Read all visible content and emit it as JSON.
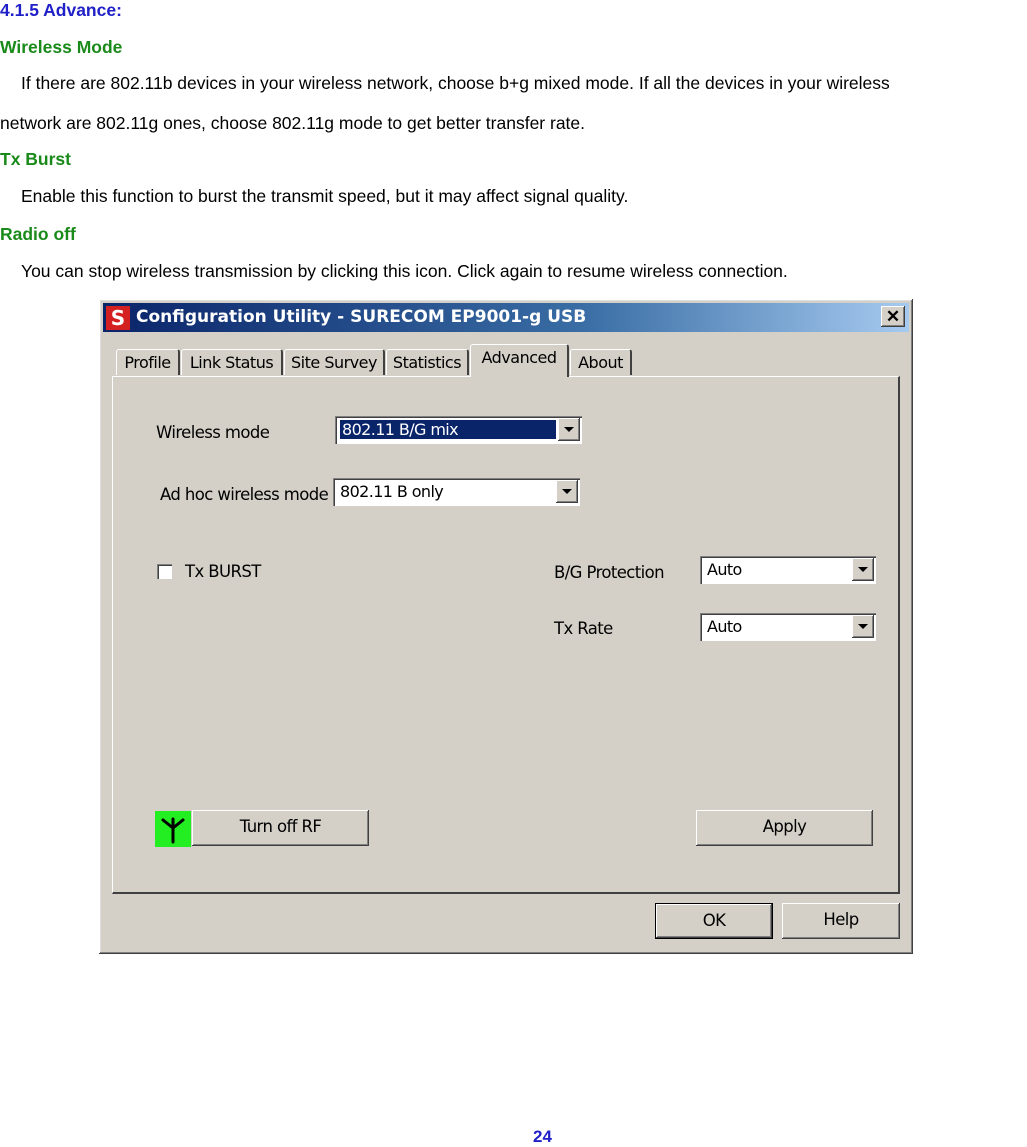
{
  "doc": {
    "section_title": "4.1.5 Advance:",
    "wireless_mode": {
      "heading": "Wireless Mode",
      "line1": "If there are 802.11b devices in your wireless network, choose b+g mixed mode. If all the devices in your wireless",
      "line2": "network are 802.11g ones, choose 802.11g mode to get better transfer rate."
    },
    "tx_burst": {
      "heading": "Tx Burst",
      "line1": "Enable this function to burst the transmit speed, but it may affect signal quality."
    },
    "radio_off": {
      "heading": "Radio off",
      "line1": "You can stop wireless transmission by clicking this icon. Click again to resume wireless connection."
    },
    "page_number": "24"
  },
  "window": {
    "icon_letter": "S",
    "title": "Configuration Utility - SURECOM EP9001-g USB",
    "close_label": "✕",
    "tabs": [
      {
        "label": "Profile"
      },
      {
        "label": "Link Status"
      },
      {
        "label": "Site Survey"
      },
      {
        "label": "Statistics"
      },
      {
        "label": "Advanced",
        "active": true
      },
      {
        "label": "About"
      }
    ],
    "advanced": {
      "wireless_mode_label": "Wireless mode",
      "wireless_mode_value": "802.11 B/G mix",
      "adhoc_mode_label": "Ad hoc wireless mode",
      "adhoc_mode_value": "802.11 B only",
      "tx_burst_label": "Tx BURST",
      "tx_burst_checked": false,
      "bg_protection_label": "B/G Protection",
      "bg_protection_value": "Auto",
      "tx_rate_label": "Tx Rate",
      "tx_rate_value": "Auto",
      "turn_off_rf_label": "Turn off RF",
      "apply_label": "Apply"
    },
    "ok_label": "OK",
    "help_label": "Help"
  },
  "colors": {
    "section_title": "#2020c8",
    "heading": "#1a8a1a",
    "rf_icon_bg": "#22ee22",
    "titlebar_start": "#0a246a",
    "titlebar_end": "#a6caf0"
  }
}
